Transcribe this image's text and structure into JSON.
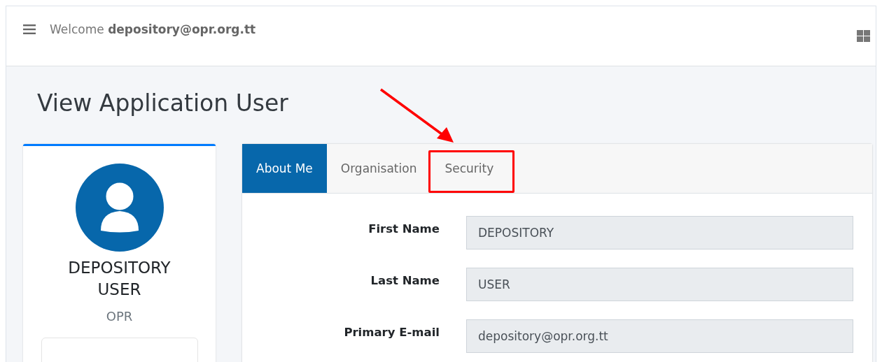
{
  "header": {
    "welcome": "Welcome **depository@opr.org.tt**"
  },
  "page_title": "View Application User",
  "profile": {
    "name": "DEPOSITORY USER",
    "organisation": "OPR"
  },
  "tabs": [
    {
      "label": "About Me",
      "selected": true,
      "highlighted": false
    },
    {
      "label": "Organisation",
      "selected": false,
      "highlighted": false
    },
    {
      "label": "Security",
      "selected": false,
      "highlighted": true
    }
  ],
  "fields": [
    {
      "label": "First Name",
      "value": "DEPOSITORY"
    },
    {
      "label": "Last Name",
      "value": "USER"
    },
    {
      "label": "Primary E-mail",
      "value": "depository@opr.org.tt"
    }
  ]
}
